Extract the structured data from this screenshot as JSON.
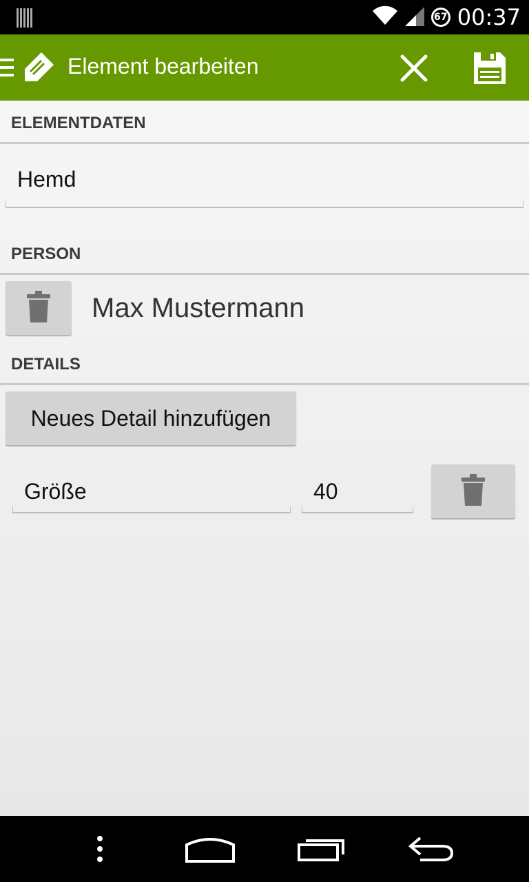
{
  "status_bar": {
    "time": "00:37",
    "battery_level": "67",
    "icons": [
      "notification-bars-icon",
      "wifi-icon",
      "signal-icon",
      "battery-icon"
    ]
  },
  "action_bar": {
    "title": "Element bearbeiten",
    "color": "#669900",
    "icons": [
      "drawer-menu-icon",
      "edit-pencil-icon",
      "close-icon",
      "save-disk-icon"
    ]
  },
  "sections": {
    "element_data_header": "ELEMENTDATEN",
    "person_header": "PERSON",
    "details_header": "DETAILS"
  },
  "element": {
    "name_value": "Hemd"
  },
  "person": {
    "name": "Max Mustermann"
  },
  "details": {
    "add_button_label": "Neues Detail hinzufügen",
    "rows": [
      {
        "key": "Größe",
        "value": "40"
      }
    ]
  },
  "nav_bar": {
    "icons": [
      "overflow-menu-icon",
      "home-icon",
      "recents-icon",
      "back-icon"
    ]
  }
}
